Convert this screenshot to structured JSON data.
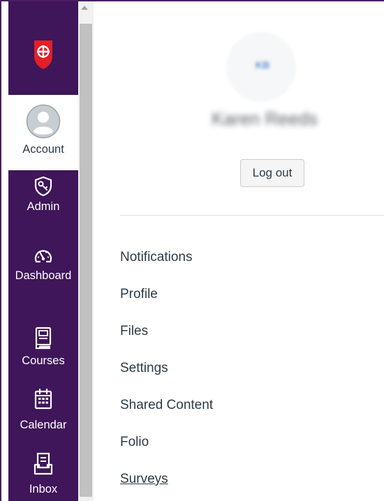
{
  "globalnav": {
    "logo_icon": "shield-cross-logo",
    "brand_red": "#e21f26",
    "nav_color": "#3f1659",
    "items": [
      {
        "id": "account",
        "label": "Account",
        "icon": "user-avatar-icon"
      },
      {
        "id": "admin",
        "label": "Admin",
        "icon": "admin-shield-icon"
      },
      {
        "id": "dashboard",
        "label": "Dashboard",
        "icon": "dashboard-gauge-icon"
      },
      {
        "id": "courses",
        "label": "Courses",
        "icon": "book-icon"
      },
      {
        "id": "calendar",
        "label": "Calendar",
        "icon": "calendar-icon"
      },
      {
        "id": "inbox",
        "label": "Inbox",
        "icon": "inbox-icon"
      }
    ]
  },
  "tray": {
    "avatar_initials": "KB",
    "user_name": "Karen Reeds",
    "logout_label": "Log out",
    "menu": [
      {
        "label": "Notifications"
      },
      {
        "label": "Profile"
      },
      {
        "label": "Files"
      },
      {
        "label": "Settings"
      },
      {
        "label": "Shared Content"
      },
      {
        "label": "Folio"
      },
      {
        "label": "Surveys"
      }
    ]
  }
}
